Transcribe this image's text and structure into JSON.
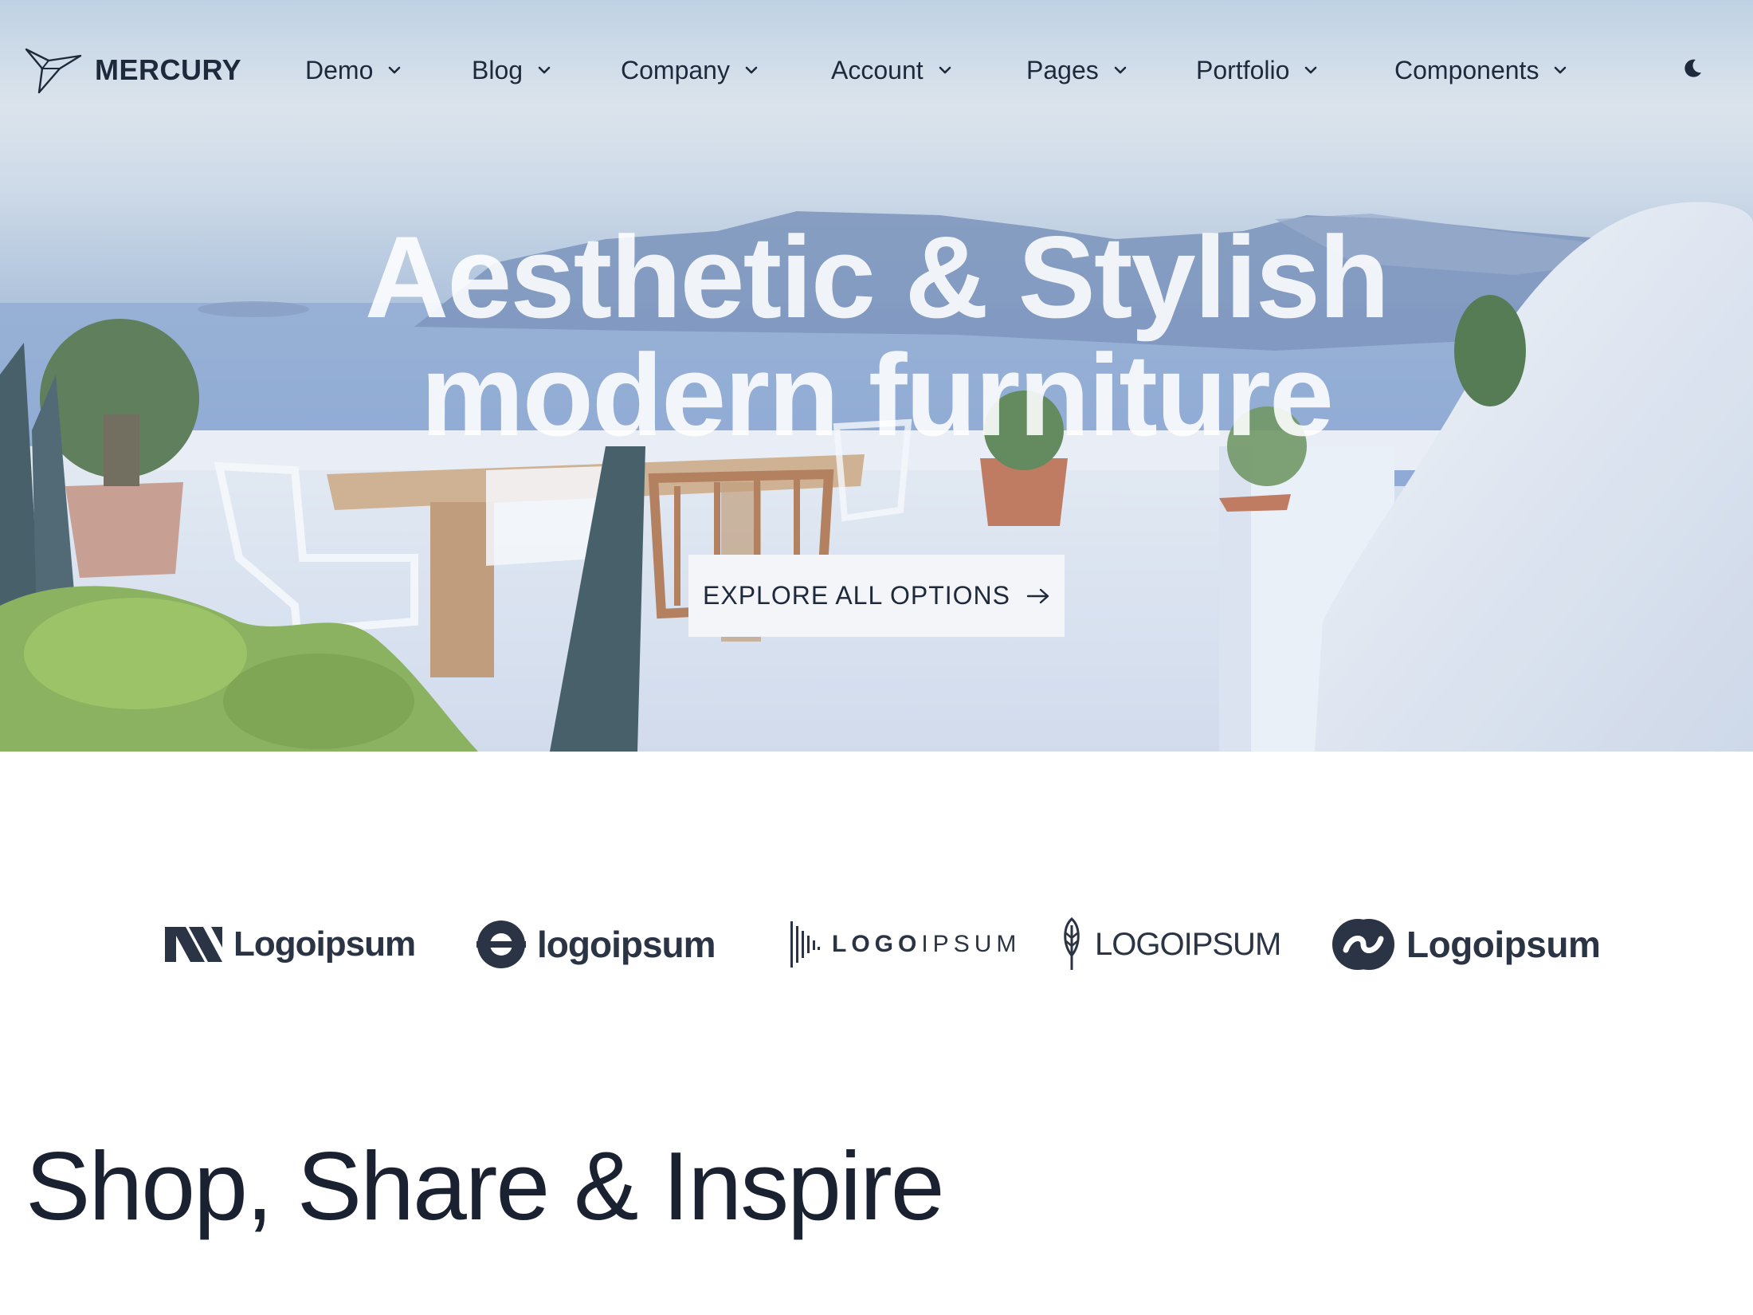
{
  "brand": {
    "name": "MERCURY",
    "icon": "paper-bird-logo"
  },
  "nav": {
    "items": [
      {
        "label": "Demo"
      },
      {
        "label": "Blog"
      },
      {
        "label": "Company"
      },
      {
        "label": "Account"
      },
      {
        "label": "Pages"
      },
      {
        "label": "Portfolio"
      },
      {
        "label": "Components"
      }
    ],
    "theme_toggle_icon": "moon-icon"
  },
  "hero": {
    "title_line1": "Aesthetic & Stylish",
    "title_line2": "modern furniture",
    "cta_label": "EXPLORE ALL OPTIONS",
    "cta_icon": "arrow-right-icon"
  },
  "logos": [
    {
      "text": "Logoipsum",
      "icon": "stripes-logo-icon"
    },
    {
      "text": "logoipsum",
      "icon": "ring-logo-icon"
    },
    {
      "text_bold": "LOGO",
      "text_light": "IPSUM",
      "icon": "bars-logo-icon"
    },
    {
      "text": "LOGOIPSUM",
      "icon": "leaf-logo-icon"
    },
    {
      "text": "Logoipsum",
      "icon": "swirl-logo-icon"
    }
  ],
  "section": {
    "title": "Shop, Share & Inspire"
  },
  "colors": {
    "text_dark": "#1e2a3b",
    "cta_bg": "#f3f5f8",
    "page_bg": "#ffffff"
  }
}
